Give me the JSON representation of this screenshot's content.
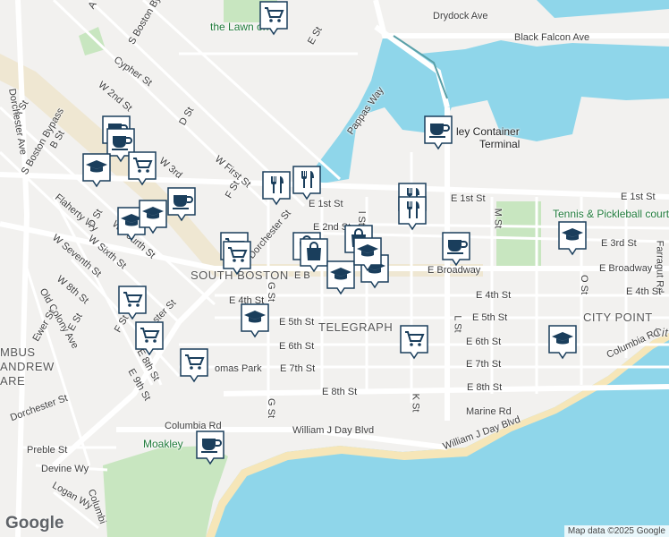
{
  "attribution": "Map data ©2025 Google",
  "logo": "Google",
  "neighborhoods": {
    "south_boston": "SOUTH BOSTON",
    "telegraph": "TELEGRAPH",
    "city_point": "CITY POINT",
    "columbus_1": "MBUS",
    "columbus_2": "ANDREW",
    "columbus_3": "ARE",
    "city_partial": "Cit"
  },
  "pois": {
    "lawn_on_d": "the Lawn on D",
    "container_terminal": "ley Container",
    "container_terminal_2": "Terminal",
    "tennis": "Tennis & Pickleball court",
    "moakley": "Moakley",
    "thomas_park": "omas Park"
  },
  "streets": {
    "drydock_ave": "Drydock Ave",
    "black_falcon_ave": "Black Falcon Ave",
    "e_st": "E St",
    "cypher_st": "Cypher St",
    "s_boston_byp_top": "S Boston Byp",
    "a_st_top": "A",
    "w_2nd_st": "W 2nd St",
    "d_st": "D St",
    "pappas_way": "Pappas Way",
    "a_st": "A St",
    "dorchester_ave": "Dorchester Ave",
    "s_boston_bypass": "S Boston Bypass",
    "b_st": "B St",
    "w_3rd_st": "W 3rd",
    "w_first_st": "W First St",
    "f_st": "F St",
    "e_1st_st": "E 1st St",
    "e_1st_st_2": "E 1st St",
    "e_1st_st_3": "E 1st St",
    "e_2nd_st": "E 2nd St",
    "l_st": "l St",
    "m_st": "M St",
    "e_3rd_st": "E 3rd St",
    "farragut_rd": "Farragut Rd",
    "flaherty_wy": "Flaherty Wy",
    "d_st_2": "D St",
    "w_fourth_st": "W Fourth St",
    "w_sixth_st": "W Sixth St",
    "w_seventh_st": "W Seventh St",
    "dorchester_st": "Dorchester St",
    "e_broadway": "E Broadway",
    "e_broadway_2": "E Broadway",
    "e_broadway_3": "E B",
    "w_8th_st": "W 8th St",
    "old_colony_ave": "Old Colony Ave",
    "e_4th_st": "E 4th St",
    "e_4th_st_2": "E 4th St",
    "e_4th_st_3": "E 4th St",
    "e_4th_st_4": "E 4th St",
    "g_st": "G St",
    "g_st_2": "G St",
    "ewer_st": "Ewer St",
    "e_st_2": "E St",
    "f_st_2": "F St",
    "e_5th_st": "E 5th St",
    "e_5th_st_2": "E 5th St",
    "e_6th_st": "E 6th St",
    "e_6th_st_2": "E 6th St",
    "e_7th_st": "E 7th St",
    "e_7th_st_2": "E 7th St",
    "e_8th_st_left": "E 8th St",
    "e_9th_st": "E 9th St",
    "ster_st": "ster St",
    "e_8th_st": "E 8th St",
    "e_8th_st_2": "E 8th St",
    "l_st_2": "L St",
    "k_st": "K St",
    "o_st": "O St",
    "marine_rd": "Marine Rd",
    "columbia_rd": "Columbia Rd",
    "columbia_rd_left": "Columbia Rd",
    "william_j_day_blvd": "William J Day Blvd",
    "william_j_day_blvd_2": "William J Day Blvd",
    "dorchester_st_2": "Dorchester St",
    "preble_st": "Preble St",
    "devine_wy": "Devine Wy",
    "logan_wy": "Logan Wy",
    "columbia_partial": "Columbi",
    "dorchester_ave_top": "Dorchester Ave"
  },
  "markers": [
    {
      "icon": "grocery",
      "label": "grocery"
    },
    {
      "icon": "coffee",
      "label": "coffee"
    },
    {
      "icon": "coffee",
      "label": "coffee"
    },
    {
      "icon": "school",
      "label": "school"
    },
    {
      "icon": "grocery",
      "label": "grocery"
    },
    {
      "icon": "coffee",
      "label": "coffee"
    },
    {
      "icon": "school",
      "label": "school"
    },
    {
      "icon": "school",
      "label": "school"
    },
    {
      "icon": "grocery",
      "label": "grocery"
    },
    {
      "icon": "restaurant",
      "label": "restaurant"
    },
    {
      "icon": "restaurant",
      "label": "restaurant"
    },
    {
      "icon": "restaurant",
      "label": "restaurant"
    },
    {
      "icon": "restaurant",
      "label": "restaurant"
    },
    {
      "icon": "shopping",
      "label": "shopping"
    },
    {
      "icon": "shopping",
      "label": "shopping"
    },
    {
      "icon": "school",
      "label": "school"
    },
    {
      "icon": "shopping",
      "label": "shopping"
    },
    {
      "icon": "grocery",
      "label": "grocery"
    },
    {
      "icon": "coffee",
      "label": "coffee"
    },
    {
      "icon": "school",
      "label": "school"
    },
    {
      "icon": "school",
      "label": "school"
    },
    {
      "icon": "grocery",
      "label": "grocery"
    },
    {
      "icon": "grocery",
      "label": "grocery"
    },
    {
      "icon": "school",
      "label": "school"
    },
    {
      "icon": "grocery",
      "label": "grocery"
    },
    {
      "icon": "school",
      "label": "school"
    },
    {
      "icon": "grocery",
      "label": "grocery"
    },
    {
      "icon": "coffee",
      "label": "coffee"
    },
    {
      "icon": "coffee",
      "label": "coffee"
    },
    {
      "icon": "school",
      "label": "school"
    }
  ]
}
